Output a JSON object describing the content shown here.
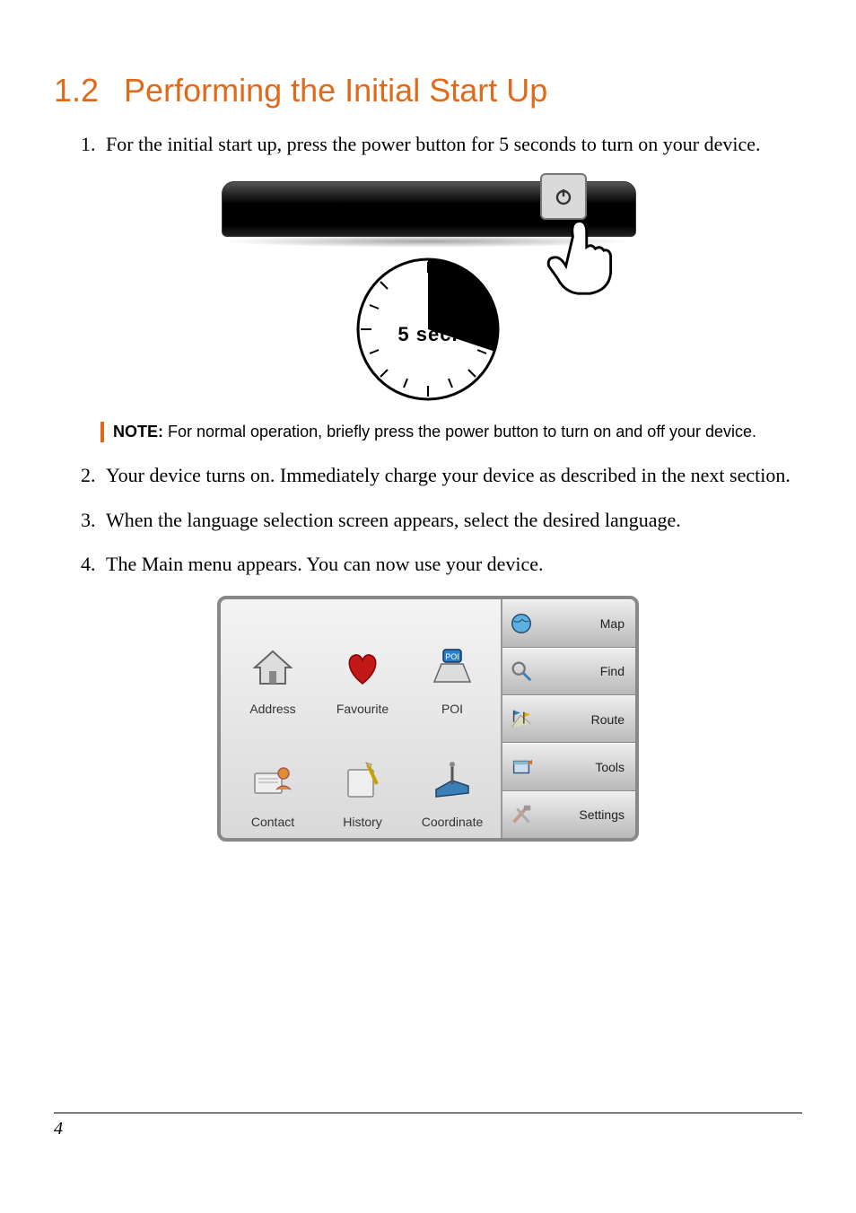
{
  "heading": {
    "number": "1.2",
    "title": "Performing the Initial Start Up"
  },
  "steps": {
    "s1": "For the initial start up, press the power button for 5 seconds to turn on your device.",
    "s2": "Your device turns on. Immediately charge your device as described in the next section.",
    "s3": "When the language selection screen appears, select the desired language.",
    "s4": "The Main menu appears. You can now use your device."
  },
  "illustration": {
    "clock_label": "5 sec."
  },
  "note": {
    "label": "NOTE:",
    "text": "For normal operation, briefly press the power button to turn on and off your device."
  },
  "menu": {
    "main": {
      "address": "Address",
      "favourite": "Favourite",
      "poi": "POI",
      "contact": "Contact",
      "history": "History",
      "coordinate": "Coordinate"
    },
    "side": {
      "map": "Map",
      "find": "Find",
      "route": "Route",
      "tools": "Tools",
      "settings": "Settings"
    }
  },
  "page_number": "4"
}
